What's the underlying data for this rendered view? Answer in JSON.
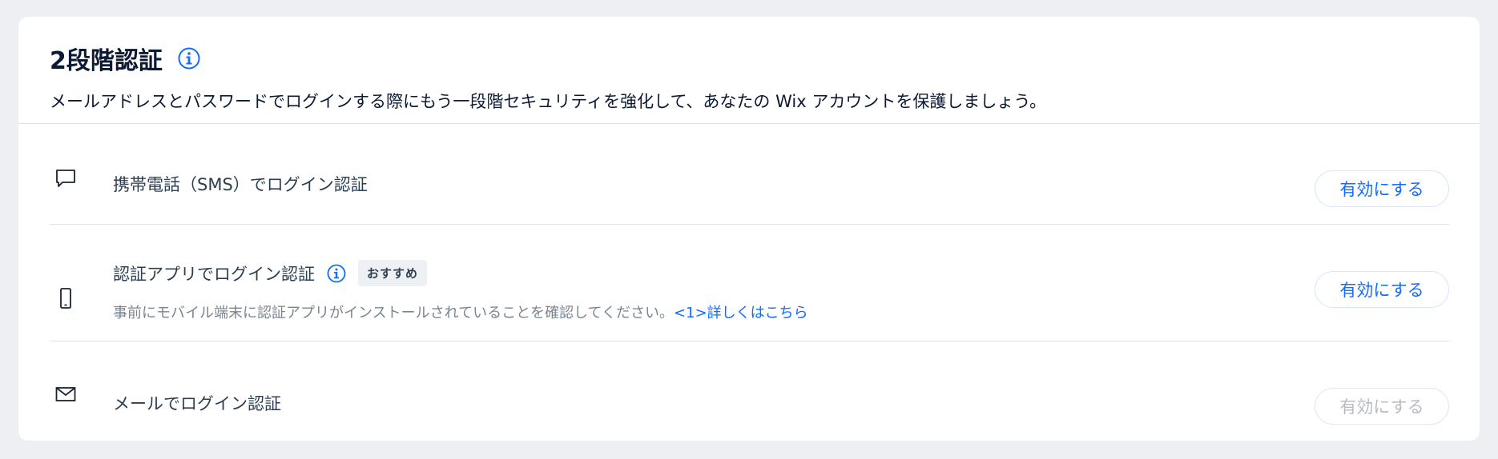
{
  "header": {
    "title": "2段階認証",
    "description": "メールアドレスとパスワードでログインする際にもう一段階セキュリティを強化して、あなたの Wix アカウントを保護しましょう。"
  },
  "methods": [
    {
      "icon": "chat-bubble-icon",
      "title": "携帯電話（SMS）でログイン認証",
      "button_label": "有効にする",
      "enabled": true
    },
    {
      "icon": "mobile-phone-icon",
      "title": "認証アプリでログイン認証",
      "badge": "おすすめ",
      "description": "事前にモバイル端末に認証アプリがインストールされていることを確認してください。",
      "link_label": "<1>詳しくはこちら",
      "button_label": "有効にする",
      "enabled": true
    },
    {
      "icon": "envelope-icon",
      "title": "メールでログイン認証",
      "button_label": "有効にする",
      "enabled": false
    }
  ],
  "colors": {
    "accent": "#116dff",
    "title": "#0c1a33",
    "disabled": "#b7bcc2"
  }
}
